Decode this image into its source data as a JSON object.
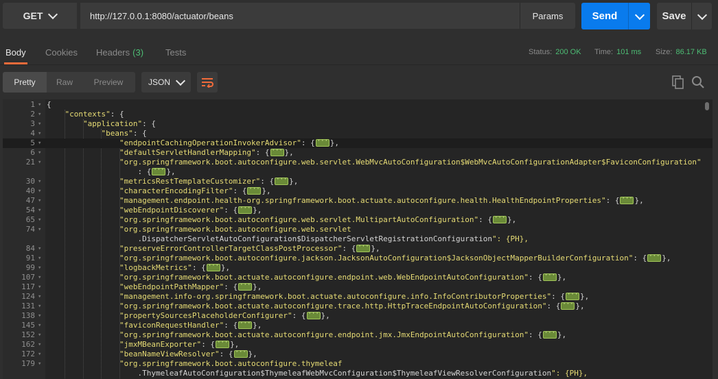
{
  "request": {
    "method": "GET",
    "url": "http://127.0.0.1:8080/actuator/beans",
    "params_label": "Params",
    "send_label": "Send",
    "save_label": "Save"
  },
  "response": {
    "tabs": [
      {
        "label": "Body"
      },
      {
        "label": "Cookies"
      },
      {
        "label": "Headers",
        "count": "(3)"
      },
      {
        "label": "Tests"
      }
    ],
    "status_label": "Status:",
    "status_value": "200 OK",
    "time_label": "Time:",
    "time_value": "101 ms",
    "size_label": "Size:",
    "size_value": "86.17 KB"
  },
  "body_toolbar": {
    "formats": [
      "Pretty",
      "Raw",
      "Preview"
    ],
    "language": "JSON"
  },
  "code_lines": [
    {
      "n": "1",
      "text": "{",
      "fold": true
    },
    {
      "n": "2",
      "text": "    \"contexts\": {",
      "fold": true
    },
    {
      "n": "3",
      "text": "        \"application\": {",
      "fold": true
    },
    {
      "n": "4",
      "text": "            \"beans\": {",
      "fold": true
    },
    {
      "n": "5",
      "text": "                \"endpointCachingOperationInvokerAdvisor\": {PH},",
      "fold": true,
      "highlight": true
    },
    {
      "n": "6",
      "text": "                \"defaultServletHandlerMapping\": {PH},",
      "fold": true
    },
    {
      "n": "21",
      "text": "                \"org.springframework.boot.autoconfigure.web.servlet.WebMvcAutoConfiguration$WebMvcAutoConfigurationAdapter$FaviconConfiguration\"",
      "fold": true
    },
    {
      "n": "",
      "text": "                    : {PH},",
      "fold": false
    },
    {
      "n": "30",
      "text": "                \"metricsRestTemplateCustomizer\": {PH},",
      "fold": true
    },
    {
      "n": "40",
      "text": "                \"characterEncodingFilter\": {PH},",
      "fold": true
    },
    {
      "n": "47",
      "text": "                \"management.endpoint.health-org.springframework.boot.actuate.autoconfigure.health.HealthEndpointProperties\": {PH},",
      "fold": true
    },
    {
      "n": "54",
      "text": "                \"webEndpointDiscoverer\": {PH},",
      "fold": true
    },
    {
      "n": "65",
      "text": "                \"org.springframework.boot.autoconfigure.web.servlet.MultipartAutoConfiguration\": {PH},",
      "fold": true
    },
    {
      "n": "74",
      "text": "                \"org.springframework.boot.autoconfigure.web.servlet",
      "fold": true
    },
    {
      "n": "",
      "text": "                    .DispatcherServletAutoConfiguration$DispatcherServletRegistrationConfiguration\": {PH},",
      "fold": false
    },
    {
      "n": "84",
      "text": "                \"preserveErrorControllerTargetClassPostProcessor\": {PH},",
      "fold": true
    },
    {
      "n": "91",
      "text": "                \"org.springframework.boot.autoconfigure.jackson.JacksonAutoConfiguration$JacksonObjectMapperBuilderConfiguration\": {PH},",
      "fold": true
    },
    {
      "n": "99",
      "text": "                \"logbackMetrics\": {PH},",
      "fold": true
    },
    {
      "n": "107",
      "text": "                \"org.springframework.boot.actuate.autoconfigure.endpoint.web.WebEndpointAutoConfiguration\": {PH},",
      "fold": true
    },
    {
      "n": "117",
      "text": "                \"webEndpointPathMapper\": {PH},",
      "fold": true
    },
    {
      "n": "124",
      "text": "                \"management.info-org.springframework.boot.actuate.autoconfigure.info.InfoContributorProperties\": {PH},",
      "fold": true
    },
    {
      "n": "131",
      "text": "                \"org.springframework.boot.actuate.autoconfigure.trace.http.HttpTraceEndpointAutoConfiguration\": {PH},",
      "fold": true
    },
    {
      "n": "138",
      "text": "                \"propertySourcesPlaceholderConfigurer\": {PH},",
      "fold": true
    },
    {
      "n": "145",
      "text": "                \"faviconRequestHandler\": {PH},",
      "fold": true
    },
    {
      "n": "152",
      "text": "                \"org.springframework.boot.actuate.autoconfigure.endpoint.jmx.JmxEndpointAutoConfiguration\": {PH},",
      "fold": true
    },
    {
      "n": "162",
      "text": "                \"jmxMBeanExporter\": {PH},",
      "fold": true
    },
    {
      "n": "172",
      "text": "                \"beanNameViewResolver\": {PH},",
      "fold": true
    },
    {
      "n": "179",
      "text": "                \"org.springframework.boot.autoconfigure.thymeleaf",
      "fold": true
    },
    {
      "n": "",
      "text": "                    .ThymeleafAutoConfiguration$ThymeleafWebMvcConfiguration$ThymeleafViewResolverConfiguration\": {PH},",
      "fold": false
    }
  ],
  "colors": {
    "accent_orange": "#f26b3a",
    "send_blue": "#097bed",
    "status_green": "#4dbd74",
    "json_string": "#e6db74"
  },
  "icons": [
    "chevron-down-icon",
    "wrap-lines-icon",
    "copy-icon",
    "search-icon",
    "collapsed-placeholder-icon"
  ]
}
